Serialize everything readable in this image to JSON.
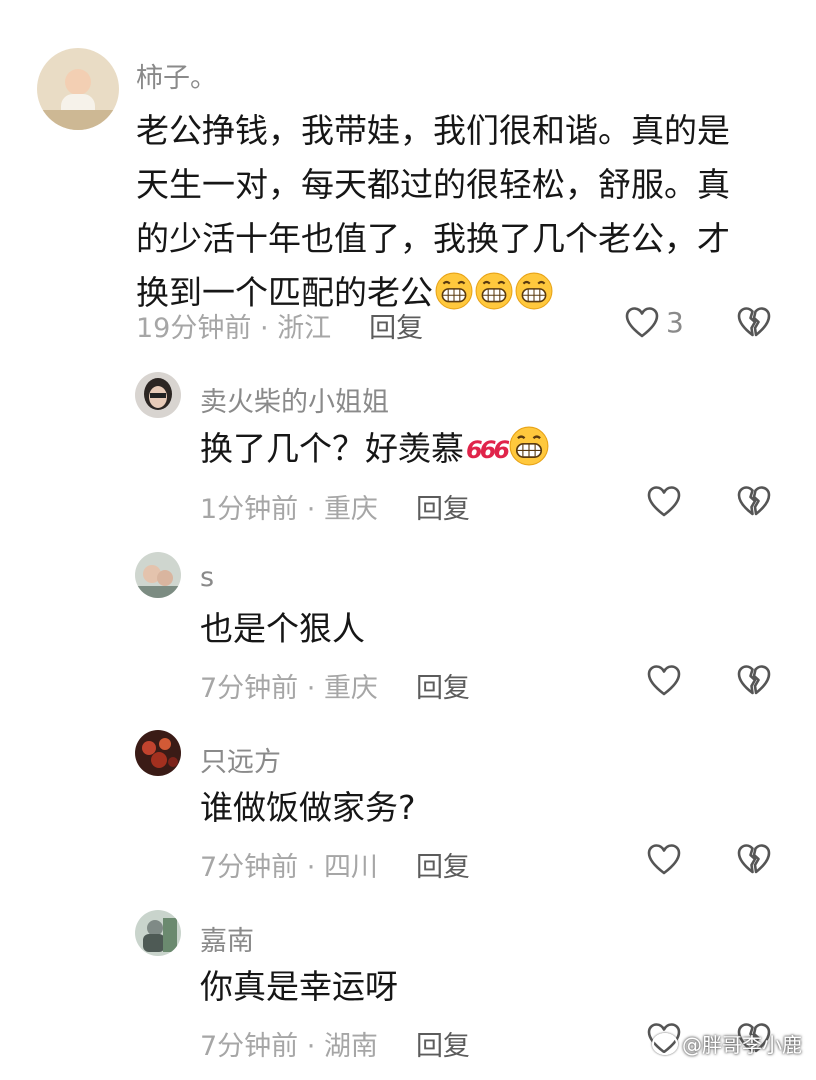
{
  "comments": [
    {
      "username": "柿子。",
      "lines": [
        "老公挣钱，我带娃，我们很和谐。真的是",
        "天生一对，每天都过的很轻松，舒服。真",
        "的少活十年也值了，我换了几个老公，才",
        "换到一个匹配的老公"
      ],
      "emojis": [
        "grin-emoji",
        "grin-emoji",
        "grin-emoji"
      ],
      "time": "19分钟前",
      "location": "浙江",
      "reply_label": "回复",
      "like_count": "3"
    },
    {
      "username": "卖火柴的小姐姐",
      "text": "换了几个？好羡慕",
      "badge_text": "666",
      "emojis": [
        "grin-emoji"
      ],
      "time": "1分钟前",
      "location": "重庆",
      "reply_label": "回复"
    },
    {
      "username": "s",
      "text": "也是个狠人",
      "time": "7分钟前",
      "location": "重庆",
      "reply_label": "回复"
    },
    {
      "username": "只远方",
      "text": "谁做饭做家务?",
      "time": "7分钟前",
      "location": "四川",
      "reply_label": "回复"
    },
    {
      "username": "嘉南",
      "text": "你真是幸运呀",
      "time": "7分钟前",
      "location": "湖南",
      "reply_label": "回复"
    }
  ],
  "meta_separator": " · ",
  "watermark": "@胖哥李小鹿",
  "colors": {
    "name": "#8a8a8a",
    "text": "#161616",
    "meta": "#a6a6a6",
    "reply": "#5c5c5c",
    "icon": "#555555"
  }
}
